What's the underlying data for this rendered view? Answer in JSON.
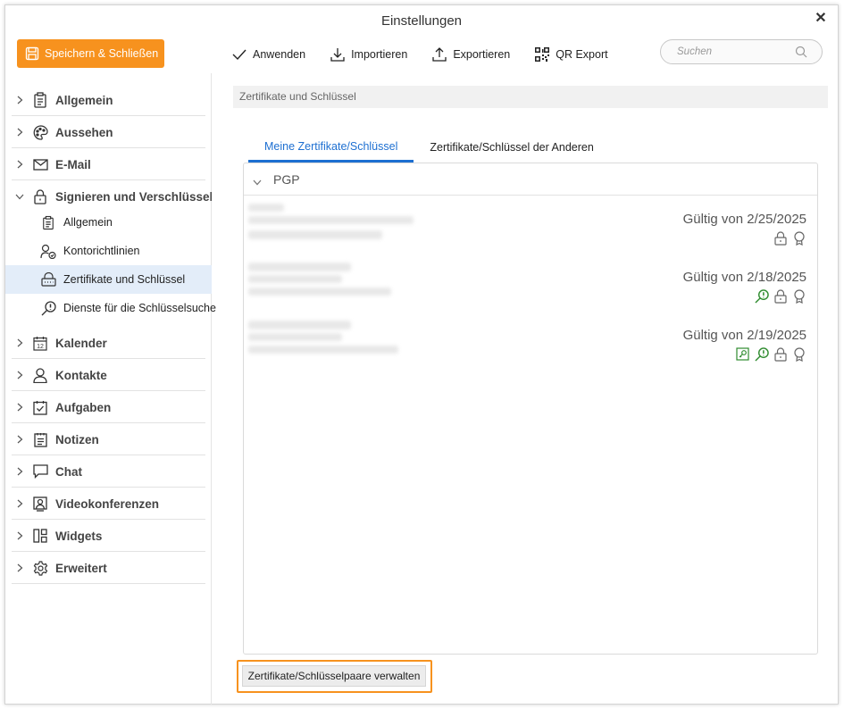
{
  "window": {
    "title": "Einstellungen"
  },
  "toolbar": {
    "save_label": "Speichern & Schließen",
    "apply_label": "Anwenden",
    "import_label": "Importieren",
    "export_label": "Exportieren",
    "qr_export_label": "QR Export"
  },
  "search": {
    "placeholder": "Suchen"
  },
  "sidebar": {
    "items": [
      {
        "label": "Allgemein",
        "icon": "clipboard-icon"
      },
      {
        "label": "Aussehen",
        "icon": "palette-icon"
      },
      {
        "label": "E-Mail",
        "icon": "envelope-icon"
      },
      {
        "label": "Signieren und Verschlüsselung",
        "icon": "lock-icon",
        "expanded": true
      },
      {
        "label": "Kalender",
        "icon": "calendar-icon"
      },
      {
        "label": "Kontakte",
        "icon": "person-icon"
      },
      {
        "label": "Aufgaben",
        "icon": "task-icon"
      },
      {
        "label": "Notizen",
        "icon": "notes-icon"
      },
      {
        "label": "Chat",
        "icon": "chat-icon"
      },
      {
        "label": "Videokonferenzen",
        "icon": "video-icon"
      },
      {
        "label": "Widgets",
        "icon": "widgets-icon"
      },
      {
        "label": "Erweitert",
        "icon": "gear-icon"
      }
    ],
    "sub_items": [
      {
        "label": "Allgemein",
        "icon": "clipboard-icon"
      },
      {
        "label": "Kontorichtlinien",
        "icon": "account-policy-icon"
      },
      {
        "label": "Zertifikate und Schlüssel",
        "icon": "certificate-lock-icon",
        "active": true
      },
      {
        "label": "Dienste für die Schlüsselsuche",
        "icon": "key-search-icon"
      }
    ],
    "calendar_icon_day": "12"
  },
  "content": {
    "breadcrumb": "Zertifikate und Schlüssel",
    "tabs": [
      {
        "label": "Meine Zertifikate/Schlüssel",
        "active": true
      },
      {
        "label": "Zertifikate/Schlüssel der Anderen",
        "active": false
      }
    ],
    "group_label": "PGP",
    "certificates": [
      {
        "validity": "Gültig von 2/25/2025",
        "badges": [
          "lock-icon",
          "award-icon"
        ]
      },
      {
        "validity": "Gültig von 2/18/2025",
        "badges": [
          "key-search-green-icon",
          "lock-icon",
          "award-icon"
        ]
      },
      {
        "validity": "Gültig von 2/19/2025",
        "badges": [
          "key-certificate-green-icon",
          "key-search-green-icon",
          "lock-icon",
          "award-icon"
        ]
      }
    ],
    "manage_button": "Zertifikate/Schlüsselpaare verwalten"
  },
  "colors": {
    "accent_orange": "#f7921e",
    "tab_blue": "#1d6fd1",
    "active_nav_bg": "#e3edf9",
    "badge_green": "#2e8b2e"
  }
}
